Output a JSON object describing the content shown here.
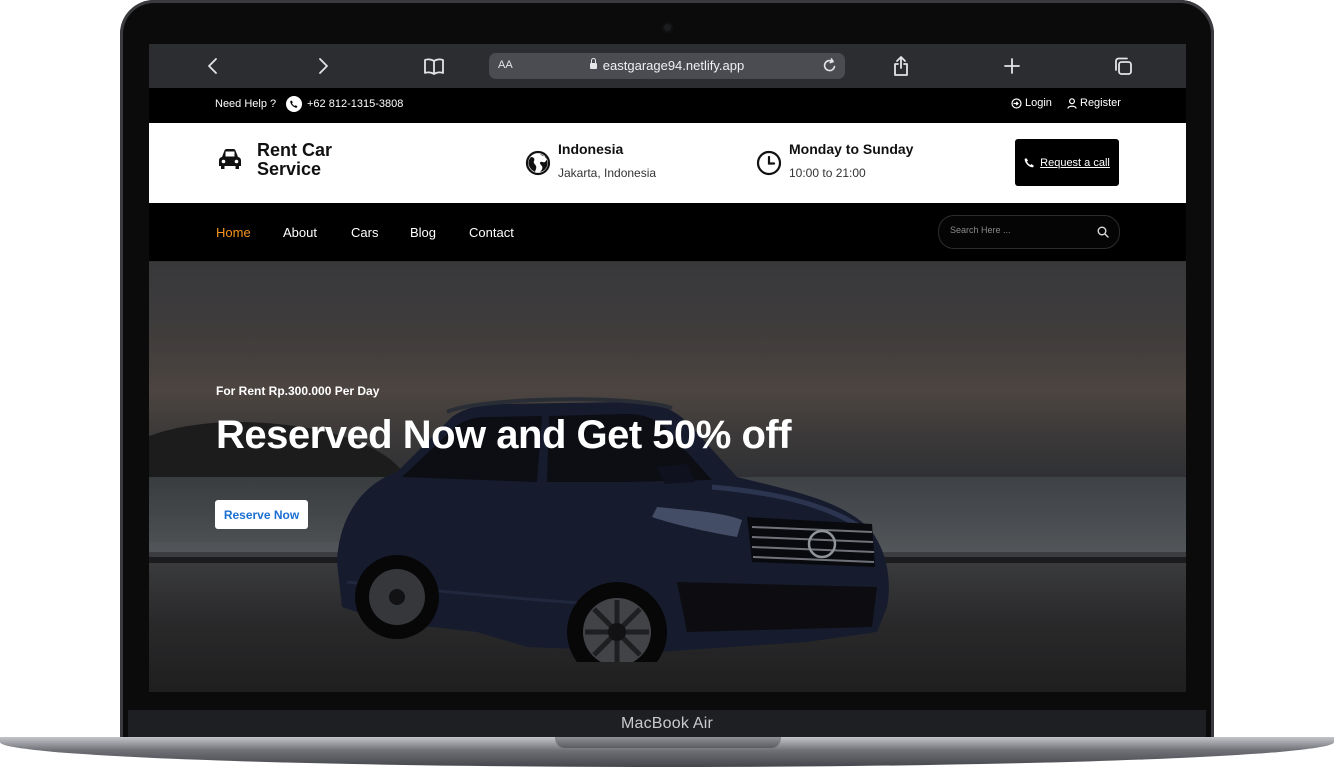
{
  "device": {
    "label": "MacBook Air"
  },
  "browser": {
    "text_size_label": "AA",
    "url": "eastgarage94.netlify.app",
    "icons": [
      "back-icon",
      "forward-icon",
      "bookmarks-icon",
      "lock-icon",
      "reload-icon",
      "share-icon",
      "new-tab-icon",
      "tabs-icon"
    ]
  },
  "topbar": {
    "help_text": "Need Help ?",
    "phone": "+62 812-1315-3808",
    "login": "Login",
    "register": "Register"
  },
  "header": {
    "brand": "Rent Car Service",
    "location_title": "Indonesia",
    "location_sub": "Jakarta, Indonesia",
    "hours_title": "Monday to Sunday",
    "hours_sub": "10:00 to 21:00",
    "cta": "Request a call"
  },
  "nav": {
    "items": [
      {
        "label": "Home",
        "active": true
      },
      {
        "label": "About"
      },
      {
        "label": "Cars"
      },
      {
        "label": "Blog"
      },
      {
        "label": "Contact"
      }
    ],
    "search_placeholder": "Search Here ..."
  },
  "hero": {
    "kicker": "For Rent Rp.300.000 Per Day",
    "title": "Reserved Now and Get 50% off",
    "button": "Reserve Now"
  },
  "colors": {
    "accent": "#f7941d",
    "link_blue": "#1b6fd1",
    "dark": "#000000"
  }
}
